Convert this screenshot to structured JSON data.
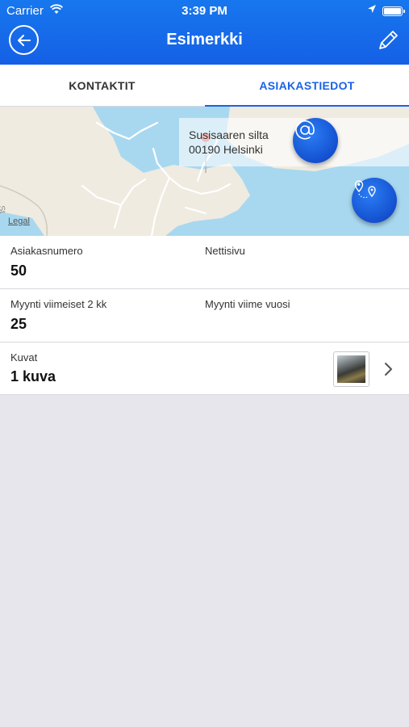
{
  "status_bar": {
    "carrier": "Carrier",
    "time": "3:39 PM"
  },
  "header": {
    "title": "Esimerkki"
  },
  "tabs": [
    {
      "label": "KONTAKTIT",
      "active": false
    },
    {
      "label": "ASIAKASTIEDOT",
      "active": true
    }
  ],
  "map": {
    "address_line1": "Susisaaren silta",
    "address_line2": "00190 Helsinki",
    "legal": "Legal"
  },
  "fields": {
    "customer_number": {
      "label": "Asiakasnumero",
      "value": "50"
    },
    "website": {
      "label": "Nettisivu",
      "value": ""
    },
    "sales_last_2_months": {
      "label": "Myynti viimeiset 2 kk",
      "value": "25"
    },
    "sales_last_year": {
      "label": "Myynti viime vuosi",
      "value": ""
    },
    "images": {
      "label": "Kuvat",
      "value": "1 kuva"
    }
  },
  "colors": {
    "accent": "#1a63e6",
    "header": "#1560e6",
    "background": "#e6e6ec"
  },
  "icons": [
    "back-arrow-icon",
    "pencil-icon",
    "at-sign-icon",
    "route-icon",
    "chevron-right-icon",
    "wifi-icon",
    "location-arrow-icon",
    "battery-icon"
  ]
}
